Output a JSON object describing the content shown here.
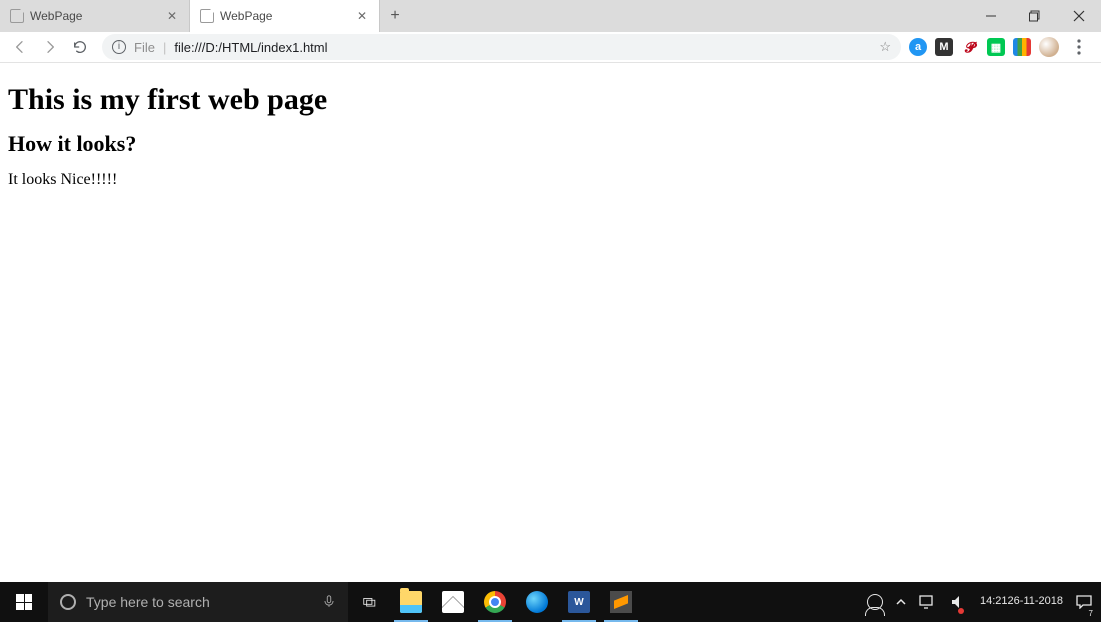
{
  "browser": {
    "tabs": [
      {
        "title": "WebPage",
        "active": false
      },
      {
        "title": "WebPage",
        "active": true
      }
    ],
    "address": {
      "scheme_label": "File",
      "url": "file:///D:/HTML/index1.html"
    },
    "extensions": {
      "a_label": "a",
      "m_label": "M",
      "word_label": "W"
    }
  },
  "page": {
    "h1": "This is my first web page",
    "h2": "How it looks?",
    "p": "It looks Nice!!!!!"
  },
  "taskbar": {
    "search_placeholder": "Type here to search",
    "time": "14:21",
    "date": "26-11-2018",
    "notif_count": "7"
  }
}
